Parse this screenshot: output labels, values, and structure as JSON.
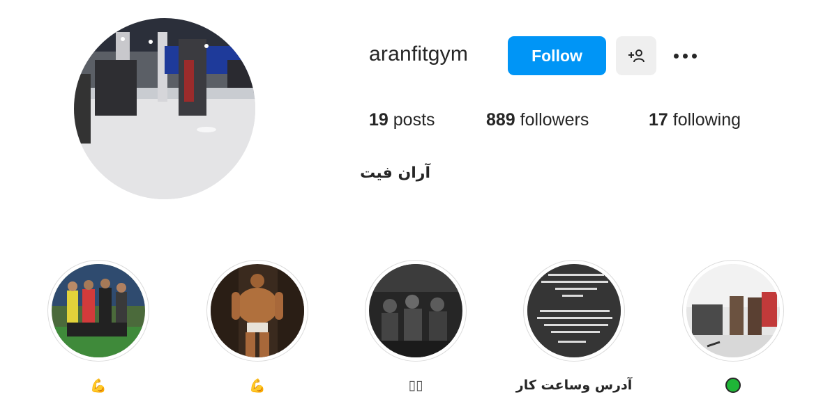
{
  "profile": {
    "username": "aranfitgym",
    "full_name": "آران فیت",
    "follow_label": "Follow",
    "suggest_icon": "add-person-icon",
    "more_icon": "ellipsis-icon"
  },
  "stats": {
    "posts_count": "19",
    "posts_label": "posts",
    "followers_count": "889",
    "followers_label": "followers",
    "following_count": "17",
    "following_label": "following"
  },
  "highlights": [
    {
      "label": "💪",
      "image": "group-of-athletes-photo"
    },
    {
      "label": "💪",
      "image": "bodybuilder-posing-photo"
    },
    {
      "label": "▯▯",
      "image": "gym-members-dark-photo"
    },
    {
      "label": "آدرس وساعت کار",
      "image": "address-text-photo"
    },
    {
      "label": "●",
      "image": "gym-interior-photo"
    }
  ],
  "colors": {
    "follow_button": "#0095f6",
    "secondary_button": "#efefef",
    "text": "#262626",
    "status_dot": "#1fb637"
  }
}
